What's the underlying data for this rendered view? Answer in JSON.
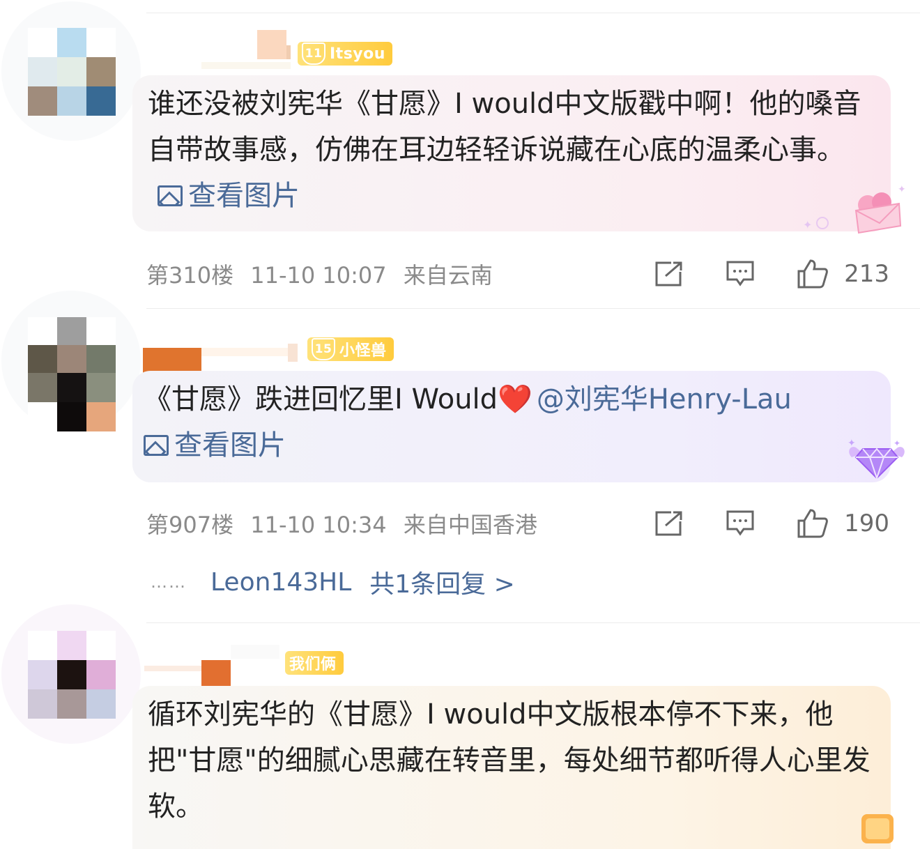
{
  "comments": [
    {
      "badge": {
        "level": "11",
        "text": "Itsyou"
      },
      "body": "谁还没被刘宪华《甘愿》I would中文版戳中啊！他的嗓音自带故事感，仿佛在耳边轻轻诉说藏在心底的温柔心事。",
      "image_link": "查看图片",
      "floor": "第310楼",
      "time": "11-10 10:07",
      "location": "来自云南",
      "likes": "213"
    },
    {
      "badge": {
        "level": "15",
        "text": "小怪兽"
      },
      "body": "《甘愿》跌进回忆里I Would",
      "emoji": "❤️",
      "mention": "@刘宪华Henry-Lau",
      "image_link": "查看图片",
      "floor": "第907楼",
      "time": "11-10 10:34",
      "location": "来自中国香港",
      "likes": "190",
      "reply_preview": {
        "dots": "……",
        "user": "Leon143HL",
        "count_text": "共1条回复 >"
      }
    },
    {
      "badge": {
        "text": "我们俩"
      },
      "body": "循环刘宪华的《甘愿》I would中文版根本停不下来，他把\"甘愿\"的细腻心思藏在转音里，每处细节都听得人心里发软。"
    }
  ],
  "icons": [
    "share-icon",
    "comment-icon",
    "like-icon",
    "image-icon"
  ],
  "colors": {
    "link": "#4a6a98",
    "meta": "#8a8a8a",
    "badge": "#ffcb3d"
  }
}
